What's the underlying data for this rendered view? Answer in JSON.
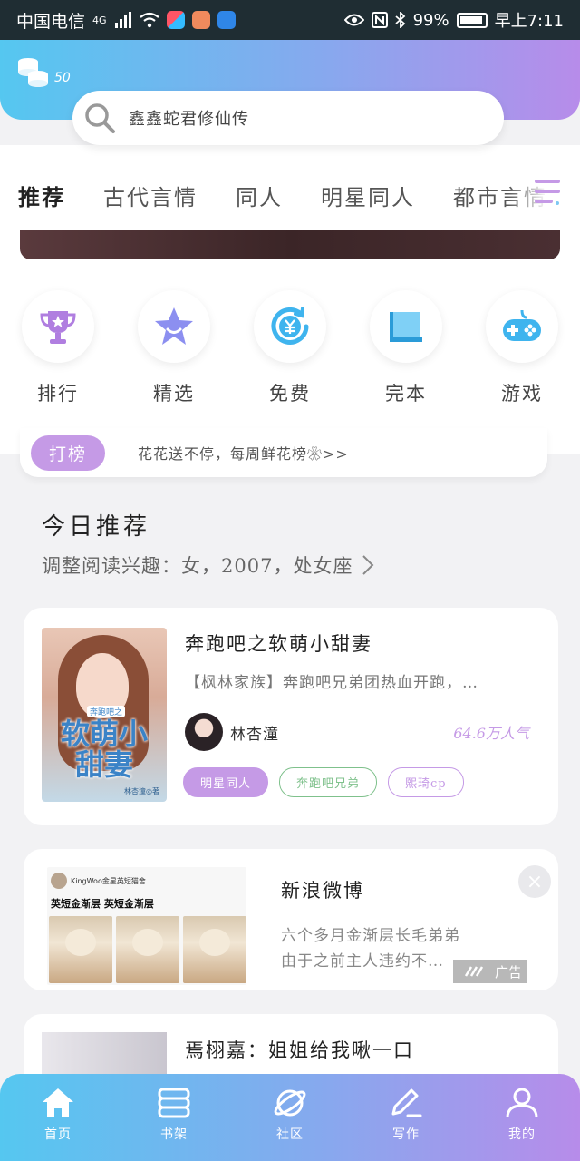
{
  "status_bar": {
    "carrier": "中国电信",
    "network": "4G",
    "battery": "99%",
    "time": "早上7:11"
  },
  "header": {
    "coins": "50",
    "search_text": "鑫鑫蛇君修仙传"
  },
  "tabs": [
    "推荐",
    "古代言情",
    "同人",
    "明星同人",
    "都市言情"
  ],
  "categories": [
    {
      "label": "排行",
      "icon": "trophy-icon"
    },
    {
      "label": "精选",
      "icon": "star-icon"
    },
    {
      "label": "免费",
      "icon": "yen-icon"
    },
    {
      "label": "完本",
      "icon": "book-icon"
    },
    {
      "label": "游戏",
      "icon": "gamepad-icon"
    }
  ],
  "rank": {
    "pill": "打榜",
    "text": "花花送不停，每周鲜花榜❀>>"
  },
  "today": {
    "title": "今日推荐",
    "subtitle": "调整阅读兴趣：女，2007，处女座"
  },
  "book": {
    "title": "奔跑吧之软萌小甜妻",
    "description": "【枫林家族】奔跑吧兄弟团热血开跑，…",
    "author": "林杏潼",
    "popularity": "64.6万人气",
    "tags": [
      "明星同人",
      "奔跑吧兄弟",
      "熙琦cp"
    ],
    "cover": {
      "title": "软萌小甜妻",
      "tag": "奔跑吧之",
      "author": "林杏潼◎著"
    }
  },
  "ad": {
    "source": "新浪微博",
    "text_line1": "六个多月金渐层长毛弟弟",
    "text_line2": "由于之前主人违约不…",
    "label": "广告",
    "image_account": "KingWoo金星英短猫舍",
    "image_headline": "英短金渐层  英短金渐层",
    "close": "×"
  },
  "third": {
    "title": "焉栩嘉：姐姐给我啾一口"
  },
  "bottom_nav": [
    {
      "label": "首页",
      "icon": "home-icon"
    },
    {
      "label": "书架",
      "icon": "bookshelf-icon"
    },
    {
      "label": "社区",
      "icon": "planet-icon"
    },
    {
      "label": "写作",
      "icon": "pen-icon"
    },
    {
      "label": "我的",
      "icon": "profile-icon"
    }
  ],
  "colors": {
    "accent": "#c59ae6",
    "gradient_start": "#55c7f0",
    "gradient_end": "#b78cea"
  }
}
